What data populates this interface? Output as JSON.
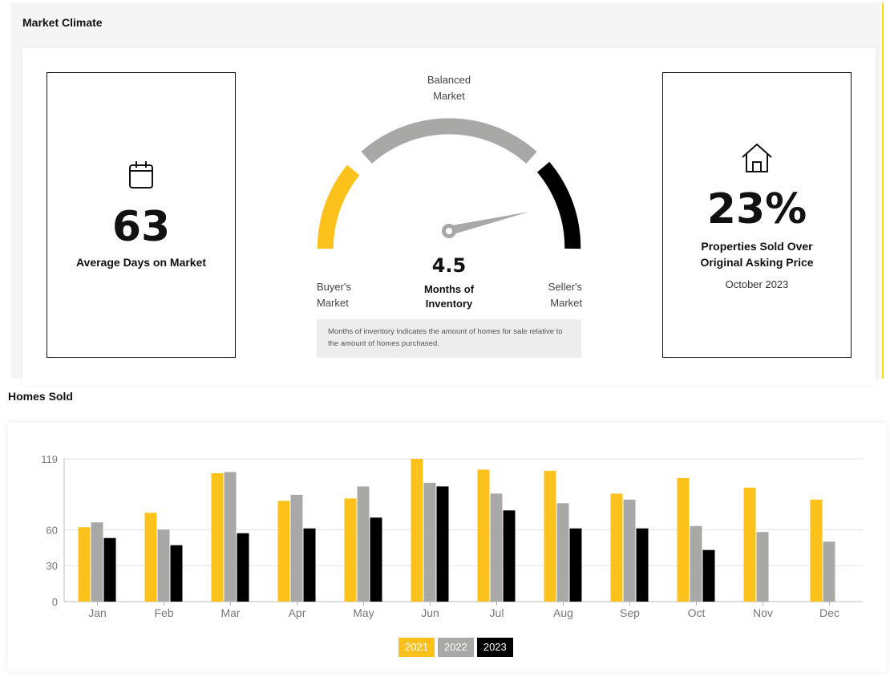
{
  "market_climate": {
    "title": "Market Climate",
    "left_stat": {
      "icon": "calendar-icon",
      "value": "63",
      "label": "Average Days on Market"
    },
    "gauge": {
      "top_label_1": "Balanced",
      "top_label_2": "Market",
      "left_label_1": "Buyer's",
      "left_label_2": "Market",
      "right_label_1": "Seller's",
      "right_label_2": "Market",
      "value": "4.5",
      "value_label_1": "Months of",
      "value_label_2": "Inventory",
      "note": "Months of inventory indicates the amount of homes for sale relative to the amount of homes purchased.",
      "needle_value": 4.5,
      "colors": {
        "buyers": "#fcc21b",
        "balanced": "#a8a8a6",
        "sellers": "#000000"
      }
    },
    "right_stat": {
      "icon": "home-icon",
      "value": "23%",
      "label_1": "Properties Sold Over",
      "label_2": "Original Asking Price",
      "sub": "October 2023"
    }
  },
  "homes_sold": {
    "title": "Homes Sold",
    "legend": [
      "2021",
      "2022",
      "2023"
    ]
  },
  "chart_data": {
    "type": "bar",
    "title": "Homes Sold",
    "categories": [
      "Jan",
      "Feb",
      "Mar",
      "Apr",
      "May",
      "Jun",
      "Jul",
      "Aug",
      "Sep",
      "Oct",
      "Nov",
      "Dec"
    ],
    "series": [
      {
        "name": "2021",
        "color": "#fcc21b",
        "values": [
          62,
          74,
          107,
          84,
          86,
          119,
          110,
          109,
          90,
          103,
          95,
          85
        ]
      },
      {
        "name": "2022",
        "color": "#a8a8a6",
        "values": [
          66,
          60,
          108,
          89,
          96,
          99,
          90,
          82,
          85,
          63,
          58,
          50
        ]
      },
      {
        "name": "2023",
        "color": "#000000",
        "values": [
          53,
          47,
          57,
          61,
          70,
          96,
          76,
          61,
          61,
          43,
          null,
          null
        ]
      }
    ],
    "yticks": [
      0,
      30,
      60,
      119
    ],
    "ylim": [
      0,
      119
    ],
    "grid": true,
    "legend_position": "bottom"
  }
}
